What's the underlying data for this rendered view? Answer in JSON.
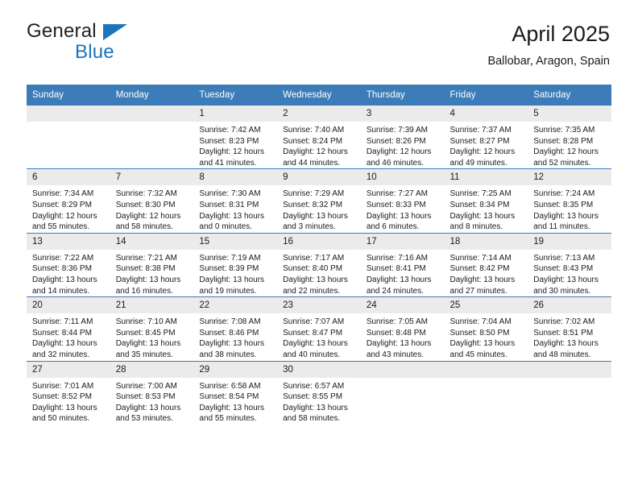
{
  "brand": {
    "name_top": "General",
    "name_bottom": "Blue",
    "triangle_color": "#1b74bd",
    "text_color": "#231f20"
  },
  "header": {
    "title": "April 2025",
    "subtitle": "Ballobar, Aragon, Spain"
  },
  "theme": {
    "header_blue": "#3c7cb8",
    "daynum_gray": "#ebebeb",
    "text": "#1a1a1a"
  },
  "weekday_headers": [
    "Sunday",
    "Monday",
    "Tuesday",
    "Wednesday",
    "Thursday",
    "Friday",
    "Saturday"
  ],
  "weeks": [
    [
      {
        "day": "",
        "sunrise": "",
        "sunset": "",
        "daylight1": "",
        "daylight2": "",
        "empty": true
      },
      {
        "day": "",
        "sunrise": "",
        "sunset": "",
        "daylight1": "",
        "daylight2": "",
        "empty": true
      },
      {
        "day": "1",
        "sunrise": "Sunrise: 7:42 AM",
        "sunset": "Sunset: 8:23 PM",
        "daylight1": "Daylight: 12 hours",
        "daylight2": "and 41 minutes."
      },
      {
        "day": "2",
        "sunrise": "Sunrise: 7:40 AM",
        "sunset": "Sunset: 8:24 PM",
        "daylight1": "Daylight: 12 hours",
        "daylight2": "and 44 minutes."
      },
      {
        "day": "3",
        "sunrise": "Sunrise: 7:39 AM",
        "sunset": "Sunset: 8:26 PM",
        "daylight1": "Daylight: 12 hours",
        "daylight2": "and 46 minutes."
      },
      {
        "day": "4",
        "sunrise": "Sunrise: 7:37 AM",
        "sunset": "Sunset: 8:27 PM",
        "daylight1": "Daylight: 12 hours",
        "daylight2": "and 49 minutes."
      },
      {
        "day": "5",
        "sunrise": "Sunrise: 7:35 AM",
        "sunset": "Sunset: 8:28 PM",
        "daylight1": "Daylight: 12 hours",
        "daylight2": "and 52 minutes."
      }
    ],
    [
      {
        "day": "6",
        "sunrise": "Sunrise: 7:34 AM",
        "sunset": "Sunset: 8:29 PM",
        "daylight1": "Daylight: 12 hours",
        "daylight2": "and 55 minutes."
      },
      {
        "day": "7",
        "sunrise": "Sunrise: 7:32 AM",
        "sunset": "Sunset: 8:30 PM",
        "daylight1": "Daylight: 12 hours",
        "daylight2": "and 58 minutes."
      },
      {
        "day": "8",
        "sunrise": "Sunrise: 7:30 AM",
        "sunset": "Sunset: 8:31 PM",
        "daylight1": "Daylight: 13 hours",
        "daylight2": "and 0 minutes."
      },
      {
        "day": "9",
        "sunrise": "Sunrise: 7:29 AM",
        "sunset": "Sunset: 8:32 PM",
        "daylight1": "Daylight: 13 hours",
        "daylight2": "and 3 minutes."
      },
      {
        "day": "10",
        "sunrise": "Sunrise: 7:27 AM",
        "sunset": "Sunset: 8:33 PM",
        "daylight1": "Daylight: 13 hours",
        "daylight2": "and 6 minutes."
      },
      {
        "day": "11",
        "sunrise": "Sunrise: 7:25 AM",
        "sunset": "Sunset: 8:34 PM",
        "daylight1": "Daylight: 13 hours",
        "daylight2": "and 8 minutes."
      },
      {
        "day": "12",
        "sunrise": "Sunrise: 7:24 AM",
        "sunset": "Sunset: 8:35 PM",
        "daylight1": "Daylight: 13 hours",
        "daylight2": "and 11 minutes."
      }
    ],
    [
      {
        "day": "13",
        "sunrise": "Sunrise: 7:22 AM",
        "sunset": "Sunset: 8:36 PM",
        "daylight1": "Daylight: 13 hours",
        "daylight2": "and 14 minutes."
      },
      {
        "day": "14",
        "sunrise": "Sunrise: 7:21 AM",
        "sunset": "Sunset: 8:38 PM",
        "daylight1": "Daylight: 13 hours",
        "daylight2": "and 16 minutes."
      },
      {
        "day": "15",
        "sunrise": "Sunrise: 7:19 AM",
        "sunset": "Sunset: 8:39 PM",
        "daylight1": "Daylight: 13 hours",
        "daylight2": "and 19 minutes."
      },
      {
        "day": "16",
        "sunrise": "Sunrise: 7:17 AM",
        "sunset": "Sunset: 8:40 PM",
        "daylight1": "Daylight: 13 hours",
        "daylight2": "and 22 minutes."
      },
      {
        "day": "17",
        "sunrise": "Sunrise: 7:16 AM",
        "sunset": "Sunset: 8:41 PM",
        "daylight1": "Daylight: 13 hours",
        "daylight2": "and 24 minutes."
      },
      {
        "day": "18",
        "sunrise": "Sunrise: 7:14 AM",
        "sunset": "Sunset: 8:42 PM",
        "daylight1": "Daylight: 13 hours",
        "daylight2": "and 27 minutes."
      },
      {
        "day": "19",
        "sunrise": "Sunrise: 7:13 AM",
        "sunset": "Sunset: 8:43 PM",
        "daylight1": "Daylight: 13 hours",
        "daylight2": "and 30 minutes."
      }
    ],
    [
      {
        "day": "20",
        "sunrise": "Sunrise: 7:11 AM",
        "sunset": "Sunset: 8:44 PM",
        "daylight1": "Daylight: 13 hours",
        "daylight2": "and 32 minutes."
      },
      {
        "day": "21",
        "sunrise": "Sunrise: 7:10 AM",
        "sunset": "Sunset: 8:45 PM",
        "daylight1": "Daylight: 13 hours",
        "daylight2": "and 35 minutes."
      },
      {
        "day": "22",
        "sunrise": "Sunrise: 7:08 AM",
        "sunset": "Sunset: 8:46 PM",
        "daylight1": "Daylight: 13 hours",
        "daylight2": "and 38 minutes."
      },
      {
        "day": "23",
        "sunrise": "Sunrise: 7:07 AM",
        "sunset": "Sunset: 8:47 PM",
        "daylight1": "Daylight: 13 hours",
        "daylight2": "and 40 minutes."
      },
      {
        "day": "24",
        "sunrise": "Sunrise: 7:05 AM",
        "sunset": "Sunset: 8:48 PM",
        "daylight1": "Daylight: 13 hours",
        "daylight2": "and 43 minutes."
      },
      {
        "day": "25",
        "sunrise": "Sunrise: 7:04 AM",
        "sunset": "Sunset: 8:50 PM",
        "daylight1": "Daylight: 13 hours",
        "daylight2": "and 45 minutes."
      },
      {
        "day": "26",
        "sunrise": "Sunrise: 7:02 AM",
        "sunset": "Sunset: 8:51 PM",
        "daylight1": "Daylight: 13 hours",
        "daylight2": "and 48 minutes."
      }
    ],
    [
      {
        "day": "27",
        "sunrise": "Sunrise: 7:01 AM",
        "sunset": "Sunset: 8:52 PM",
        "daylight1": "Daylight: 13 hours",
        "daylight2": "and 50 minutes."
      },
      {
        "day": "28",
        "sunrise": "Sunrise: 7:00 AM",
        "sunset": "Sunset: 8:53 PM",
        "daylight1": "Daylight: 13 hours",
        "daylight2": "and 53 minutes."
      },
      {
        "day": "29",
        "sunrise": "Sunrise: 6:58 AM",
        "sunset": "Sunset: 8:54 PM",
        "daylight1": "Daylight: 13 hours",
        "daylight2": "and 55 minutes."
      },
      {
        "day": "30",
        "sunrise": "Sunrise: 6:57 AM",
        "sunset": "Sunset: 8:55 PM",
        "daylight1": "Daylight: 13 hours",
        "daylight2": "and 58 minutes."
      },
      {
        "day": "",
        "sunrise": "",
        "sunset": "",
        "daylight1": "",
        "daylight2": "",
        "empty": true
      },
      {
        "day": "",
        "sunrise": "",
        "sunset": "",
        "daylight1": "",
        "daylight2": "",
        "empty": true
      },
      {
        "day": "",
        "sunrise": "",
        "sunset": "",
        "daylight1": "",
        "daylight2": "",
        "empty": true
      }
    ]
  ]
}
